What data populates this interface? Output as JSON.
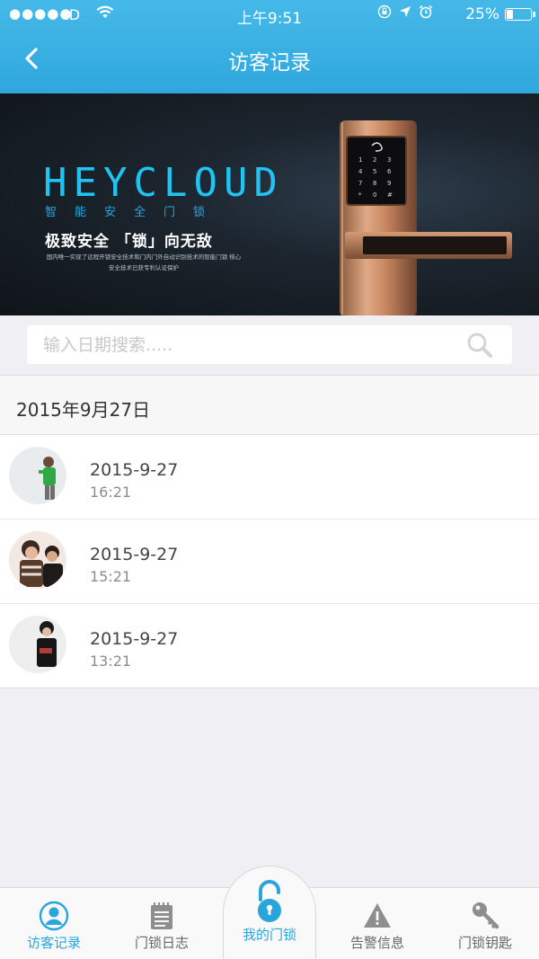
{
  "status_bar": {
    "signal": "●●●●●",
    "carrier": "ID",
    "time": "上午9:51",
    "battery_percent": "25%",
    "battery_level": 0.25
  },
  "nav": {
    "title": "访客记录",
    "back_icon": "chevron-left-icon"
  },
  "banner": {
    "brand": "HEYCLOUD",
    "brand_subtitle": "智能安全门锁",
    "slogan": "极致安全 「锁」向无敌",
    "description": "国内唯一实现了远程开锁安全技术和门内门外自动识别技术的智能门锁 核心安全技术已获专利认证保护"
  },
  "search": {
    "placeholder": "输入日期搜索.....",
    "value": "",
    "icon": "search-icon"
  },
  "section": {
    "date_header": "2015年9月27日"
  },
  "visits": [
    {
      "date": "2015-9-27",
      "time": "16:21"
    },
    {
      "date": "2015-9-27",
      "time": "15:21"
    },
    {
      "date": "2015-9-27",
      "time": "13:21"
    }
  ],
  "tabs": {
    "visitor_records": "访客记录",
    "lock_log": "门锁日志",
    "my_lock": "我的门锁",
    "alerts": "告警信息",
    "lock_keys": "门锁钥匙"
  },
  "colors": {
    "accent": "#2aa5dc",
    "header": "#3aafe2",
    "brand": "#1fc4f2"
  }
}
